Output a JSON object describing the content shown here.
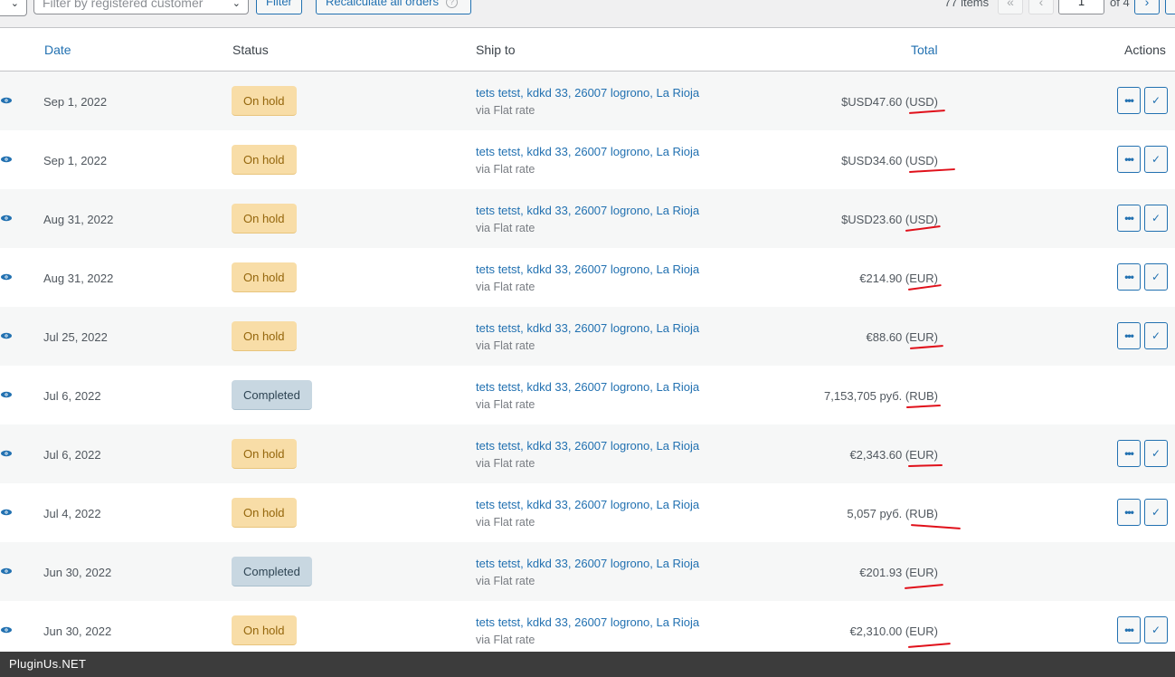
{
  "toolbar": {
    "customer_placeholder": "Filter by registered customer",
    "filter_label": "Filter",
    "recalc_label": "Recalculate all orders",
    "help_glyph": "?",
    "items_count": "77 items",
    "first_glyph": "«",
    "prev_glyph": "‹",
    "current_page": "1",
    "of_pages": "of 4",
    "next_glyph": "›"
  },
  "columns": {
    "date": "Date",
    "status": "Status",
    "ship_to": "Ship to",
    "total": "Total",
    "actions": "Actions"
  },
  "colors": {
    "link": "#2271b1",
    "on_hold_bg": "#f8dda7",
    "completed_bg": "#c8d7e1",
    "annotation_red": "#e0101a",
    "footer_bg": "#3c3c3c"
  },
  "rows": [
    {
      "date": "Sep 1, 2022",
      "status": "On hold",
      "ship": "tets tetst, kdkd 33, 26007 logrono, La Rioja",
      "via": "via Flat rate",
      "total": "$USD47.60 (USD)",
      "actions": true
    },
    {
      "date": "Sep 1, 2022",
      "status": "On hold",
      "ship": "tets tetst, kdkd 33, 26007 logrono, La Rioja",
      "via": "via Flat rate",
      "total": "$USD34.60 (USD)",
      "actions": true
    },
    {
      "date": "Aug 31, 2022",
      "status": "On hold",
      "ship": "tets tetst, kdkd 33, 26007 logrono, La Rioja",
      "via": "via Flat rate",
      "total": "$USD23.60 (USD)",
      "actions": true
    },
    {
      "date": "Aug 31, 2022",
      "status": "On hold",
      "ship": "tets tetst, kdkd 33, 26007 logrono, La Rioja",
      "via": "via Flat rate",
      "total": "€214.90 (EUR)",
      "actions": true
    },
    {
      "date": "Jul 25, 2022",
      "status": "On hold",
      "ship": "tets tetst, kdkd 33, 26007 logrono, La Rioja",
      "via": "via Flat rate",
      "total": "€88.60 (EUR)",
      "actions": true
    },
    {
      "date": "Jul 6, 2022",
      "status": "Completed",
      "ship": "tets tetst, kdkd 33, 26007 logrono, La Rioja",
      "via": "via Flat rate",
      "total": "7,153,705 руб. (RUB)",
      "actions": false
    },
    {
      "date": "Jul 6, 2022",
      "status": "On hold",
      "ship": "tets tetst, kdkd 33, 26007 logrono, La Rioja",
      "via": "via Flat rate",
      "total": "€2,343.60 (EUR)",
      "actions": true
    },
    {
      "date": "Jul 4, 2022",
      "status": "On hold",
      "ship": "tets tetst, kdkd 33, 26007 logrono, La Rioja",
      "via": "via Flat rate",
      "total": "5,057 руб. (RUB)",
      "actions": true
    },
    {
      "date": "Jun 30, 2022",
      "status": "Completed",
      "ship": "tets tetst, kdkd 33, 26007 logrono, La Rioja",
      "via": "via Flat rate",
      "total": "€201.93 (EUR)",
      "actions": false
    },
    {
      "date": "Jun 30, 2022",
      "status": "On hold",
      "ship": "tets tetst, kdkd 33, 26007 logrono, La Rioja",
      "via": "via Flat rate",
      "total": "€2,310.00 (EUR)",
      "actions": true
    }
  ],
  "action_glyphs": {
    "more": "•••",
    "check": "✓"
  },
  "footer": {
    "brand": "PluginUs.NET"
  }
}
